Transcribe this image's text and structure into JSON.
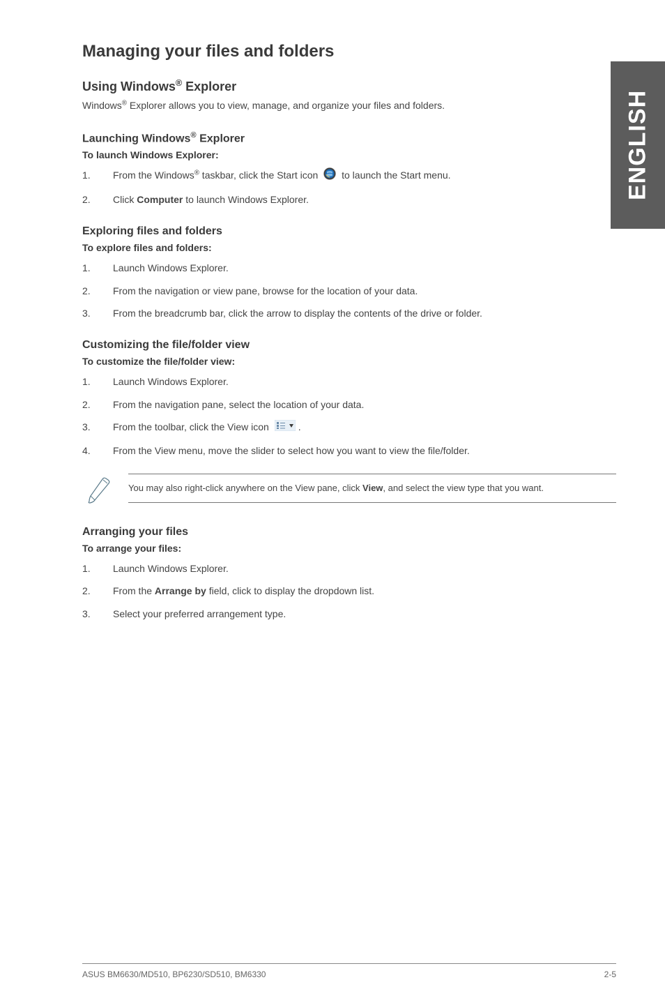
{
  "side_tab": "ENGLISH",
  "main_heading": "Managing your files and folders",
  "section1": {
    "heading_prefix": "Using Windows",
    "heading_suffix": " Explorer",
    "para_prefix": "Windows",
    "para_suffix": " Explorer allows you to view, manage, and organize your files and folders."
  },
  "launching": {
    "heading_prefix": "Launching Windows",
    "heading_suffix": " Explorer",
    "subhead": "To launch Windows Explorer:",
    "step1_before": "From the Windows",
    "step1_mid": " taskbar, click the Start icon ",
    "step1_after": " to launch the Start menu.",
    "step2_before": "Click ",
    "step2_strong": "Computer",
    "step2_after": " to launch Windows Explorer."
  },
  "exploring": {
    "heading": "Exploring files and folders",
    "subhead": "To explore files and folders:",
    "step1": "Launch Windows Explorer.",
    "step2": "From the navigation or view pane, browse for the location of your data.",
    "step3": "From the breadcrumb bar, click the arrow to display the contents of the drive or folder."
  },
  "customizing": {
    "heading": "Customizing the file/folder view",
    "subhead": "To customize the file/folder view:",
    "step1": "Launch Windows Explorer.",
    "step2": "From the navigation pane, select the location of your data.",
    "step3_before": "From the toolbar, click the View icon ",
    "step3_after": ".",
    "step4": "From the View menu, move the slider to select how you want to view the file/folder."
  },
  "note": {
    "text_before": "You may also right-click anywhere on the View pane, click ",
    "text_strong": "View",
    "text_after": ", and select the view type that you want."
  },
  "arranging": {
    "heading": "Arranging your files",
    "subhead": "To arrange your files:",
    "step1": "Launch Windows Explorer.",
    "step2_before": "From the ",
    "step2_strong": "Arrange by",
    "step2_after": " field, click to display the dropdown list.",
    "step3": "Select your preferred arrangement type."
  },
  "footer": {
    "left": "ASUS BM6630/MD510, BP6230/SD510, BM6330",
    "right": "2-5"
  }
}
